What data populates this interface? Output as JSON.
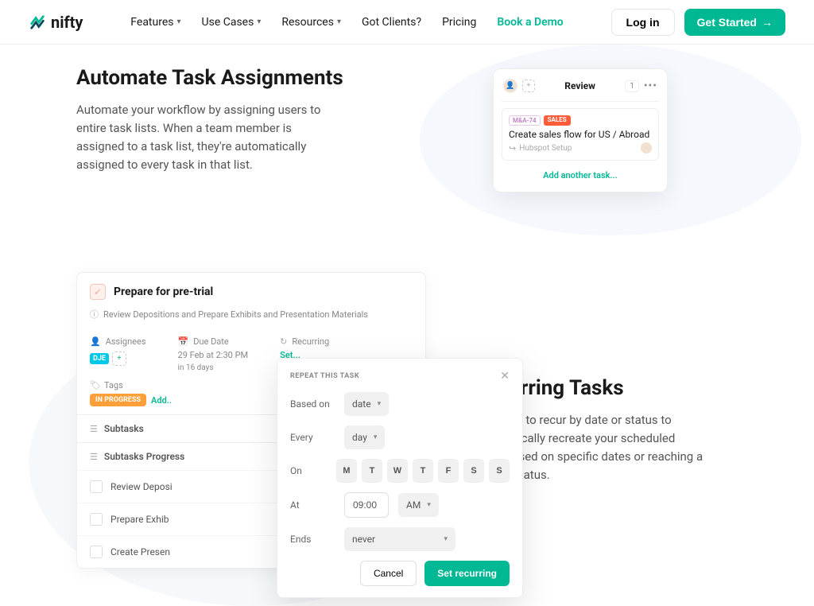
{
  "header": {
    "logo_text": "nifty",
    "nav": {
      "features": "Features",
      "use_cases": "Use Cases",
      "resources": "Resources",
      "got_clients": "Got Clients?",
      "pricing": "Pricing",
      "book_demo": "Book a Demo"
    },
    "login": "Log in",
    "get_started": "Get Started"
  },
  "section1": {
    "title": "Automate Task Assignments",
    "desc": "Automate your workflow by assigning users to entire task lists. When a team member is assigned to a task list, they're automatically assigned to every task in that list.",
    "card": {
      "column_title": "Review",
      "count": "1",
      "task_id": "M&A-74",
      "task_tag": "SALES",
      "task_text": "Create sales flow for US / Abroad",
      "task_sub": "Hubspot Setup",
      "add_task": "Add another task..."
    }
  },
  "section2": {
    "title": "Recurring Tasks",
    "desc": "Set tasks to recur by date or status to automatically recreate your scheduled tasks based on specific dates or reaching a certain status.",
    "panel": {
      "title": "Prepare for pre-trial",
      "subtitle": "Review Depositions and Prepare Exhibits and Presentation Materials",
      "assignees_label": "Assignees",
      "assignee_tag": "DJE",
      "due_label": "Due Date",
      "due_val": "29 Feb at 2:30 PM",
      "due_val2": "in 16 days",
      "recurring_label": "Recurring",
      "recurring_val": "Set...",
      "tags_label": "Tags",
      "tags_val": "IN PROGRESS",
      "tags_add": "Add..",
      "subtasks_label": "Subtasks",
      "subtasks_progress": "Subtasks Progress",
      "sub1": "Review Deposi",
      "sub2": "Prepare Exhib",
      "sub3": "Create Presen"
    },
    "popover": {
      "title": "REPEAT THIS TASK",
      "based_on_label": "Based on",
      "based_on_val": "date",
      "every_label": "Every",
      "every_val": "day",
      "on_label": "On",
      "days": [
        "M",
        "T",
        "W",
        "T",
        "F",
        "S",
        "S"
      ],
      "at_label": "At",
      "at_val": "09:00",
      "ampm": "AM",
      "ends_label": "Ends",
      "ends_val": "never",
      "cancel": "Cancel",
      "set": "Set recurring"
    }
  }
}
